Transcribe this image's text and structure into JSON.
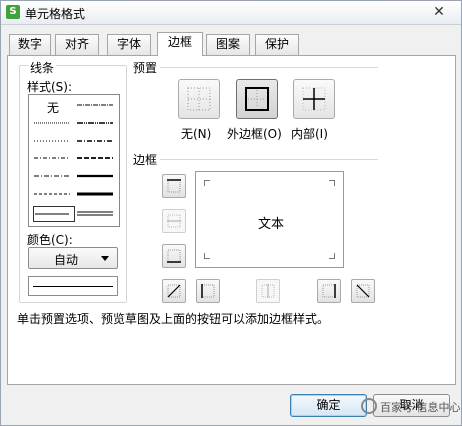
{
  "window": {
    "title": "单元格格式",
    "app_icon": "S",
    "close_glyph": "✕"
  },
  "tabs": [
    {
      "label": "数字",
      "active": false
    },
    {
      "label": "对齐",
      "active": false
    },
    {
      "label": "字体",
      "active": false
    },
    {
      "label": "边框",
      "active": true
    },
    {
      "label": "图案",
      "active": false
    },
    {
      "label": "保护",
      "active": false
    }
  ],
  "line": {
    "group_label": "线条",
    "style_label": "样式(S):",
    "style_none_label": "无",
    "color_label": "颜色(C):",
    "color_value": "自动"
  },
  "presets": {
    "group_label": "预置",
    "items": [
      {
        "label": "无(N)",
        "icon": "preset-none-icon",
        "active": false
      },
      {
        "label": "外边框(O)",
        "icon": "preset-outline-icon",
        "active": true
      },
      {
        "label": "内部(I)",
        "icon": "preset-inside-icon",
        "active": false
      }
    ]
  },
  "border": {
    "group_label": "边框",
    "preview_text": "文本"
  },
  "hint": "单击预置选项、预览草图及上面的按钮可以添加边框样式。",
  "buttons": {
    "ok": "确定",
    "cancel": "取消"
  },
  "watermark": "百家号·信息中心",
  "colors": {
    "ok_border": "#3c7fb1",
    "app_icon_bg": "#3fa33a"
  }
}
